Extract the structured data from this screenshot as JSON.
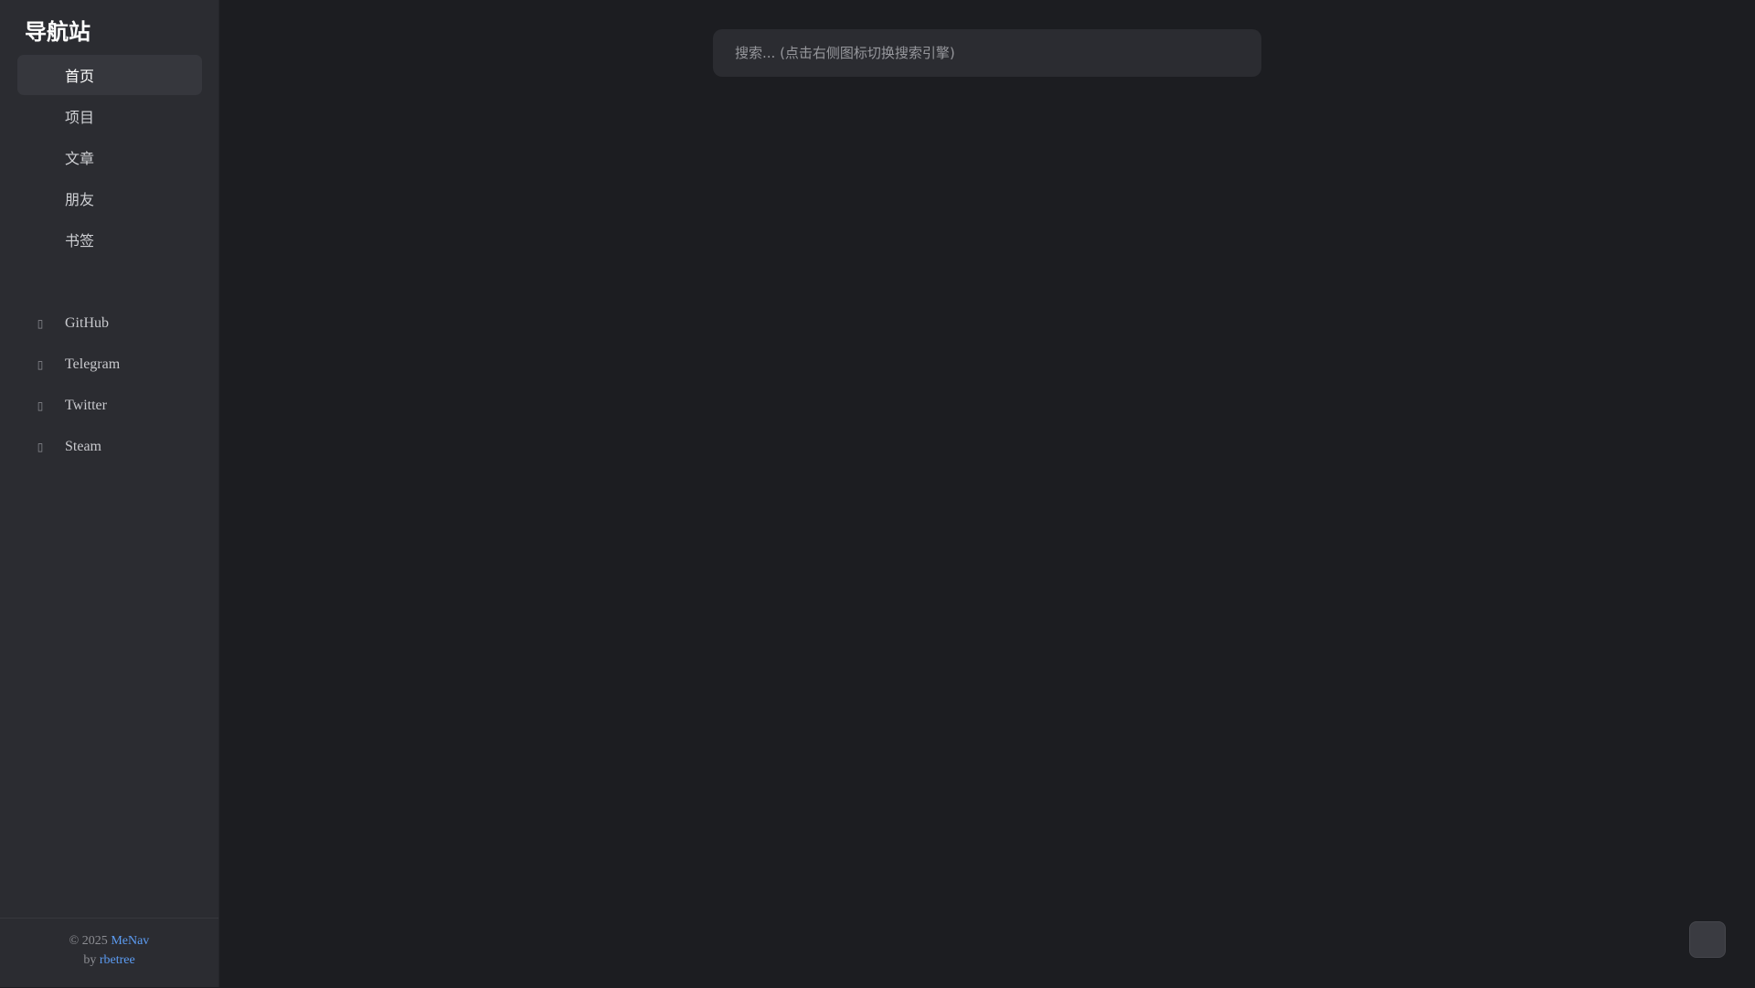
{
  "brand": {
    "title": "导航站"
  },
  "sidebar": {
    "nav_items": [
      {
        "label": "首页",
        "icon": "home-icon",
        "active": true
      },
      {
        "label": "项目",
        "icon": "project-icon",
        "active": false
      },
      {
        "label": "文章",
        "icon": "article-icon",
        "active": false
      },
      {
        "label": "朋友",
        "icon": "friends-icon",
        "active": false
      },
      {
        "label": "书签",
        "icon": "bookmark-icon",
        "active": false
      }
    ],
    "social_items": [
      {
        "label": "GitHub",
        "icon": "github-icon",
        "glyph": "▯"
      },
      {
        "label": "Telegram",
        "icon": "telegram-icon",
        "glyph": "▯"
      },
      {
        "label": "Twitter",
        "icon": "twitter-icon",
        "glyph": "▯"
      },
      {
        "label": "Steam",
        "icon": "steam-icon",
        "glyph": "▯"
      }
    ]
  },
  "footer": {
    "copyright": "© 2025",
    "project_link": "MeNav",
    "by": "by",
    "author_link": "rbetree"
  },
  "search": {
    "placeholder": "搜索... (点击右侧图标切换搜索引擎)",
    "value": ""
  },
  "colors": {
    "background": "#1c1d21",
    "sidebar": "#2b2c31",
    "accent_link": "#5c9cf3"
  }
}
